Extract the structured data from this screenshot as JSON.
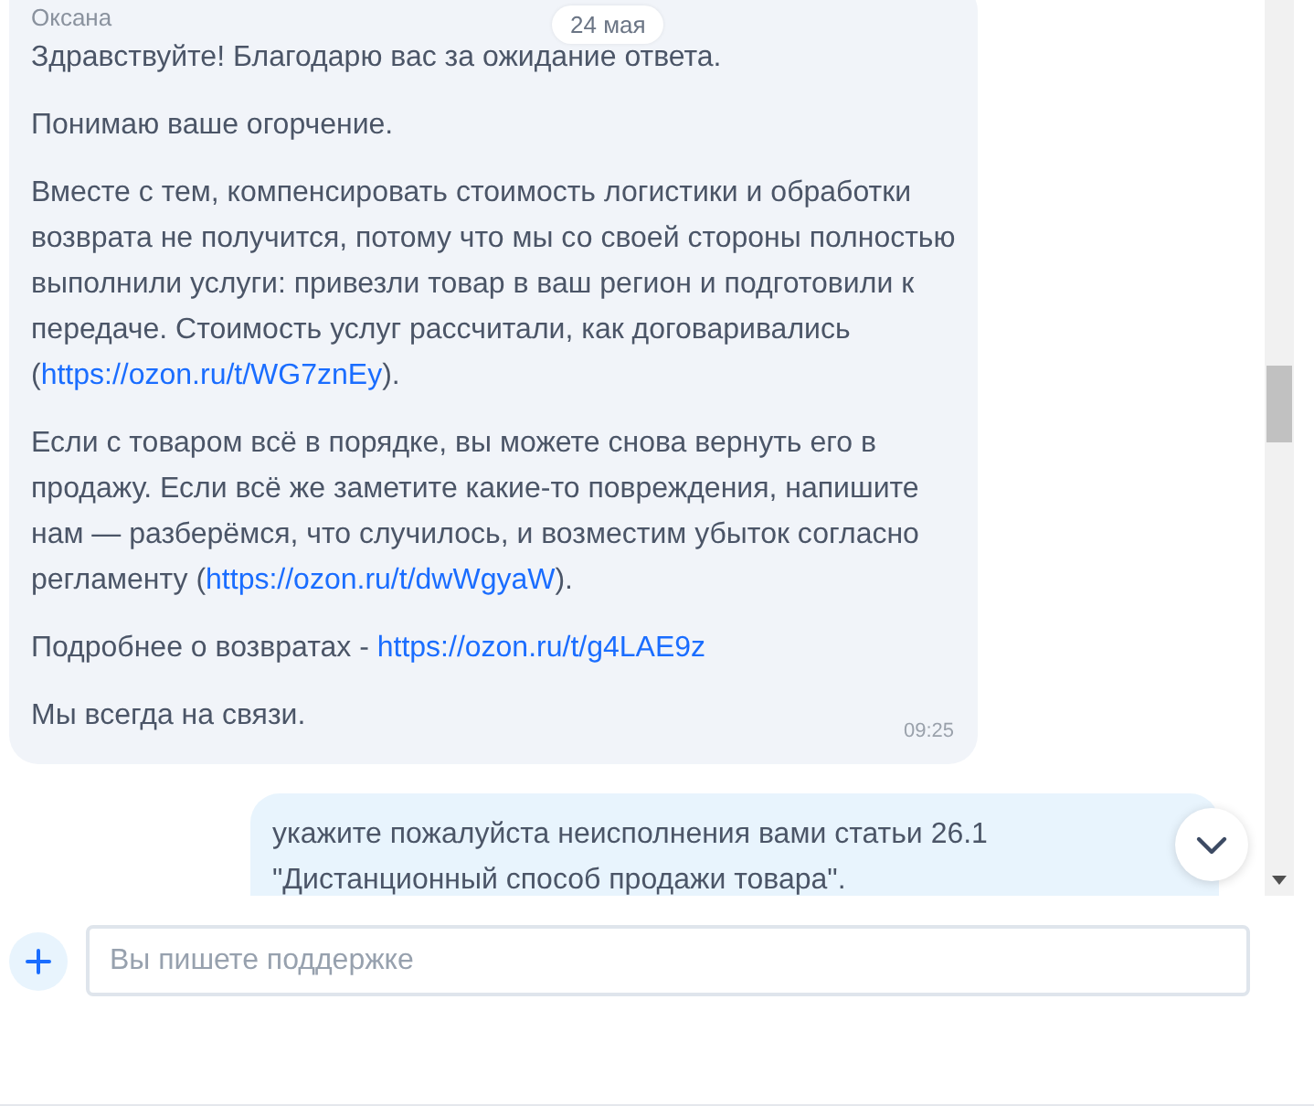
{
  "date_badge": "24 мая",
  "messages": [
    {
      "kind": "incoming",
      "sender": "Оксана",
      "time": "09:25",
      "paragraphs": [
        [
          {
            "kind": "text",
            "text": "Здравствуйте! Благодарю вас за ожидание ответа."
          }
        ],
        [
          {
            "kind": "text",
            "text": "Понимаю ваше огорчение."
          }
        ],
        [
          {
            "kind": "text",
            "text": "Вместе с тем, компенсировать стоимость логистики и обработки возврата не получится, потому что мы со своей стороны полностью выполнили услуги: привезли товар в ваш регион и подготовили к передаче. Стоимость услуг рассчитали, как договаривались ("
          },
          {
            "kind": "link",
            "text": "https://ozon.ru/t/WG7znEy"
          },
          {
            "kind": "text",
            "text": ")."
          }
        ],
        [
          {
            "kind": "text",
            "text": "Если с товаром всё в порядке, вы можете снова вернуть его в продажу. Если всё же заметите какие-то повреждения, напишите нам — разберёмся, что случилось, и возместим убыток согласно регламенту ("
          },
          {
            "kind": "link",
            "text": "https://ozon.ru/t/dwWgyaW"
          },
          {
            "kind": "text",
            "text": ")."
          }
        ],
        [
          {
            "kind": "text",
            "text": "Подробнее о возвратах - "
          },
          {
            "kind": "link",
            "text": "https://ozon.ru/t/g4LAE9z"
          }
        ],
        [
          {
            "kind": "text",
            "text": "Мы всегда на связи."
          }
        ]
      ]
    },
    {
      "kind": "outgoing",
      "paragraphs": [
        [
          {
            "kind": "text",
            "text": "укажите пожалуйста неисполнения вами статьи 26.1 \"Дистанционный способ продажи товара\"."
          }
        ]
      ]
    }
  ],
  "composer": {
    "placeholder": "Вы пишете поддержке"
  }
}
